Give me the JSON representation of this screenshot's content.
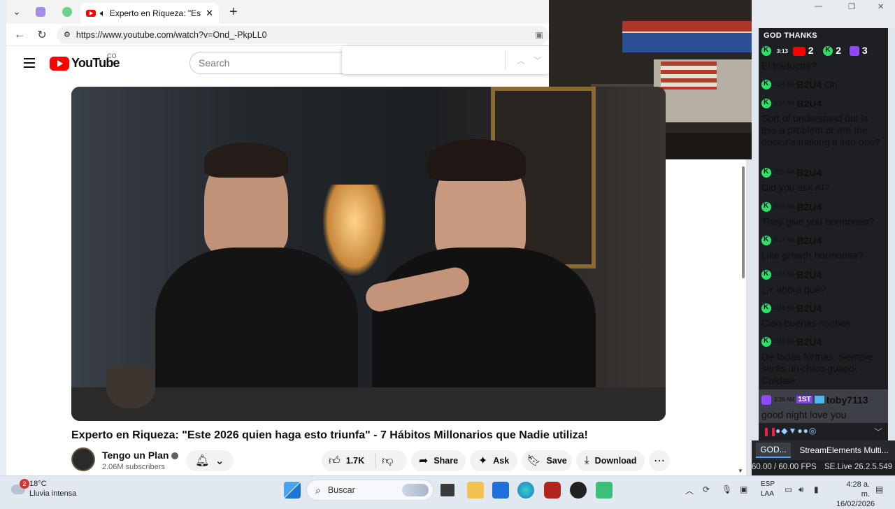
{
  "browser": {
    "tab_title": "Experto en Riqueza: \"Este 2026",
    "url": "https://www.youtube.com/watch?v=Ond_-PkpLL0"
  },
  "youtube": {
    "logo_text": "YouTube",
    "country_code": "CO",
    "search_placeholder": "Search",
    "video_title": "Experto en Riqueza: \"Este 2026 quien haga esto triunfa\" - 7 Hábitos Millonarios que Nadie utiliza!",
    "channel_name": "Tengo un Plan",
    "subscribers": "2.06M subscribers",
    "likes": "1.7K",
    "share_label": "Share",
    "ask_label": "Ask",
    "save_label": "Save",
    "download_label": "Download"
  },
  "chat": {
    "header": "GOD THANKS",
    "stats": {
      "youtube": "2",
      "kick": "2",
      "twitch": "3"
    },
    "messages": [
      {
        "time": "3:13",
        "user": "",
        "text": "El traductor?"
      },
      {
        "time": "3:14 AM",
        "user": "B2U4",
        "text": "Oh"
      },
      {
        "time": "3:14 AM",
        "user": "B2U4",
        "text": "Sort of understand but is this a problem or are the doctor's making it into one?"
      },
      {
        "time": "3:15 AM",
        "user": "B2U4",
        "text": "Did you ask AI?"
      },
      {
        "time": "3:16 AM",
        "user": "B2U4",
        "text": "They give you hormones?"
      },
      {
        "time": "3:17 AM",
        "user": "B2U4",
        "text": "Like growth hormones?"
      },
      {
        "time": "3:17 AM",
        "user": "B2U4",
        "text": "¿Y ahora qué?"
      },
      {
        "time": "3:18 AM",
        "user": "B2U4",
        "text": "Ciao buenas noches"
      },
      {
        "time": "3:19 AM",
        "user": "B2U4",
        "text": "De todas formas, siempre serás un chico guapo. Cuídate."
      },
      {
        "time": "3:39 AM",
        "user": "toby7113",
        "text": "good night love you",
        "badge": "1ST"
      }
    ]
  },
  "obs": {
    "scene_button": "GOD...",
    "source_button": "StreamElements Multi...",
    "fps": "60.00 / 60.00 FPS",
    "version": "SE.Live 26.2.5.549"
  },
  "taskbar": {
    "weather_temp": "18°C",
    "weather_desc": "Lluvia intensa",
    "weather_badge": "2",
    "search_label": "Buscar",
    "lang_top": "ESP",
    "lang_bottom": "LAA",
    "time": "4:28 a. m.",
    "date": "16/02/2026"
  },
  "colors": {
    "youtube_red": "#ff0000",
    "kick_green": "#2ee06a",
    "twitch_purple": "#9146ff",
    "chat_bg": "#1d1f22"
  }
}
